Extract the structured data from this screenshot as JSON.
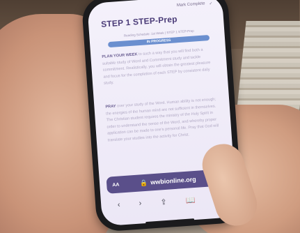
{
  "screen": {
    "topbar_status": "Mark Complete",
    "title": "STEP 1 STEP-Prep",
    "subtitle": "Reading Schedule: 1st Week | STEP 1 STEP-Prep",
    "progress_label": "IN PROGRESS",
    "paragraph1_lead": "PLAN YOUR WEEK",
    "paragraph1_body": "to such a way that you will find both a suitable study of Word and Commitment study and tackle commitment. Realistically, you will obtain the greatest pleasure and focus for the completion of each STEP by consistent daily study.",
    "paragraph2_lead": "PRAY",
    "paragraph2_body": "over your study of the Word. Human ability is not enough; the energies of the human mind are not sufficient in themselves. The Christian student requires the ministry of the Holy Spirit in order to understand the sense of the Word, and whereby proper application can be made to one’s personal life. Pray that God will translate your studies into the activity for Christ."
  },
  "browser": {
    "aa_label": "AA",
    "url": "wwbionline.org",
    "lock_icon": "lock-icon",
    "reload_icon": "reload-icon",
    "toolbar": {
      "back": "‹",
      "forward": "›",
      "share": "⇪",
      "bookmarks": "📖",
      "tabs": "⧉"
    }
  }
}
